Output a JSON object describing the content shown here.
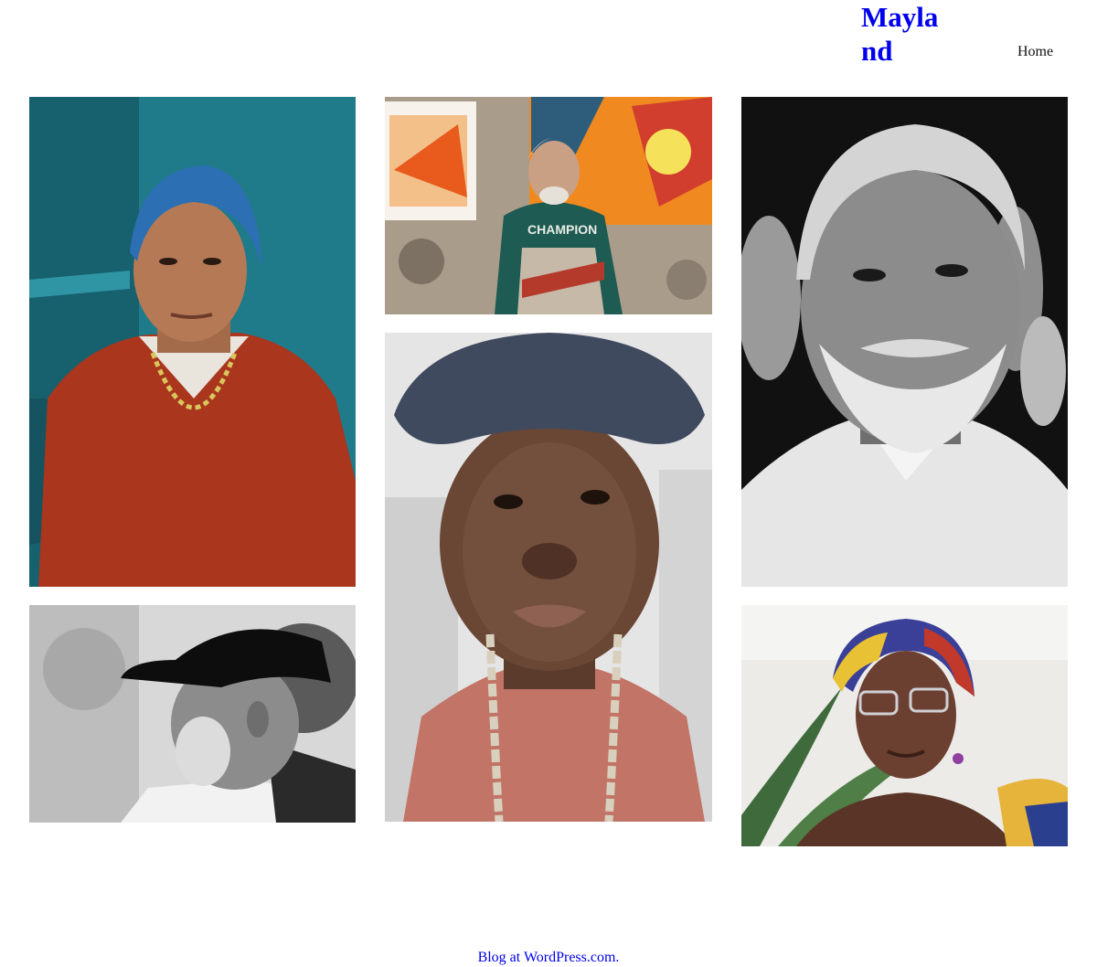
{
  "header": {
    "site_title": "Mayland",
    "nav": [
      {
        "label": "Home"
      }
    ]
  },
  "gallery": {
    "photos": [
      {
        "subject": "woman-blue-headscarf-red-sweater"
      },
      {
        "subject": "man-black-cap-profile-bw"
      },
      {
        "subject": "painter-champion-shirt-apron"
      },
      {
        "subject": "young-man-cap-chain"
      },
      {
        "subject": "older-man-white-beard-bw"
      },
      {
        "subject": "woman-colorful-headwrap-glasses"
      }
    ]
  },
  "footer": {
    "link_label": "Blog at WordPress.com."
  },
  "colors": {
    "link": "#0000ee",
    "text": "#111111",
    "background": "#ffffff"
  }
}
